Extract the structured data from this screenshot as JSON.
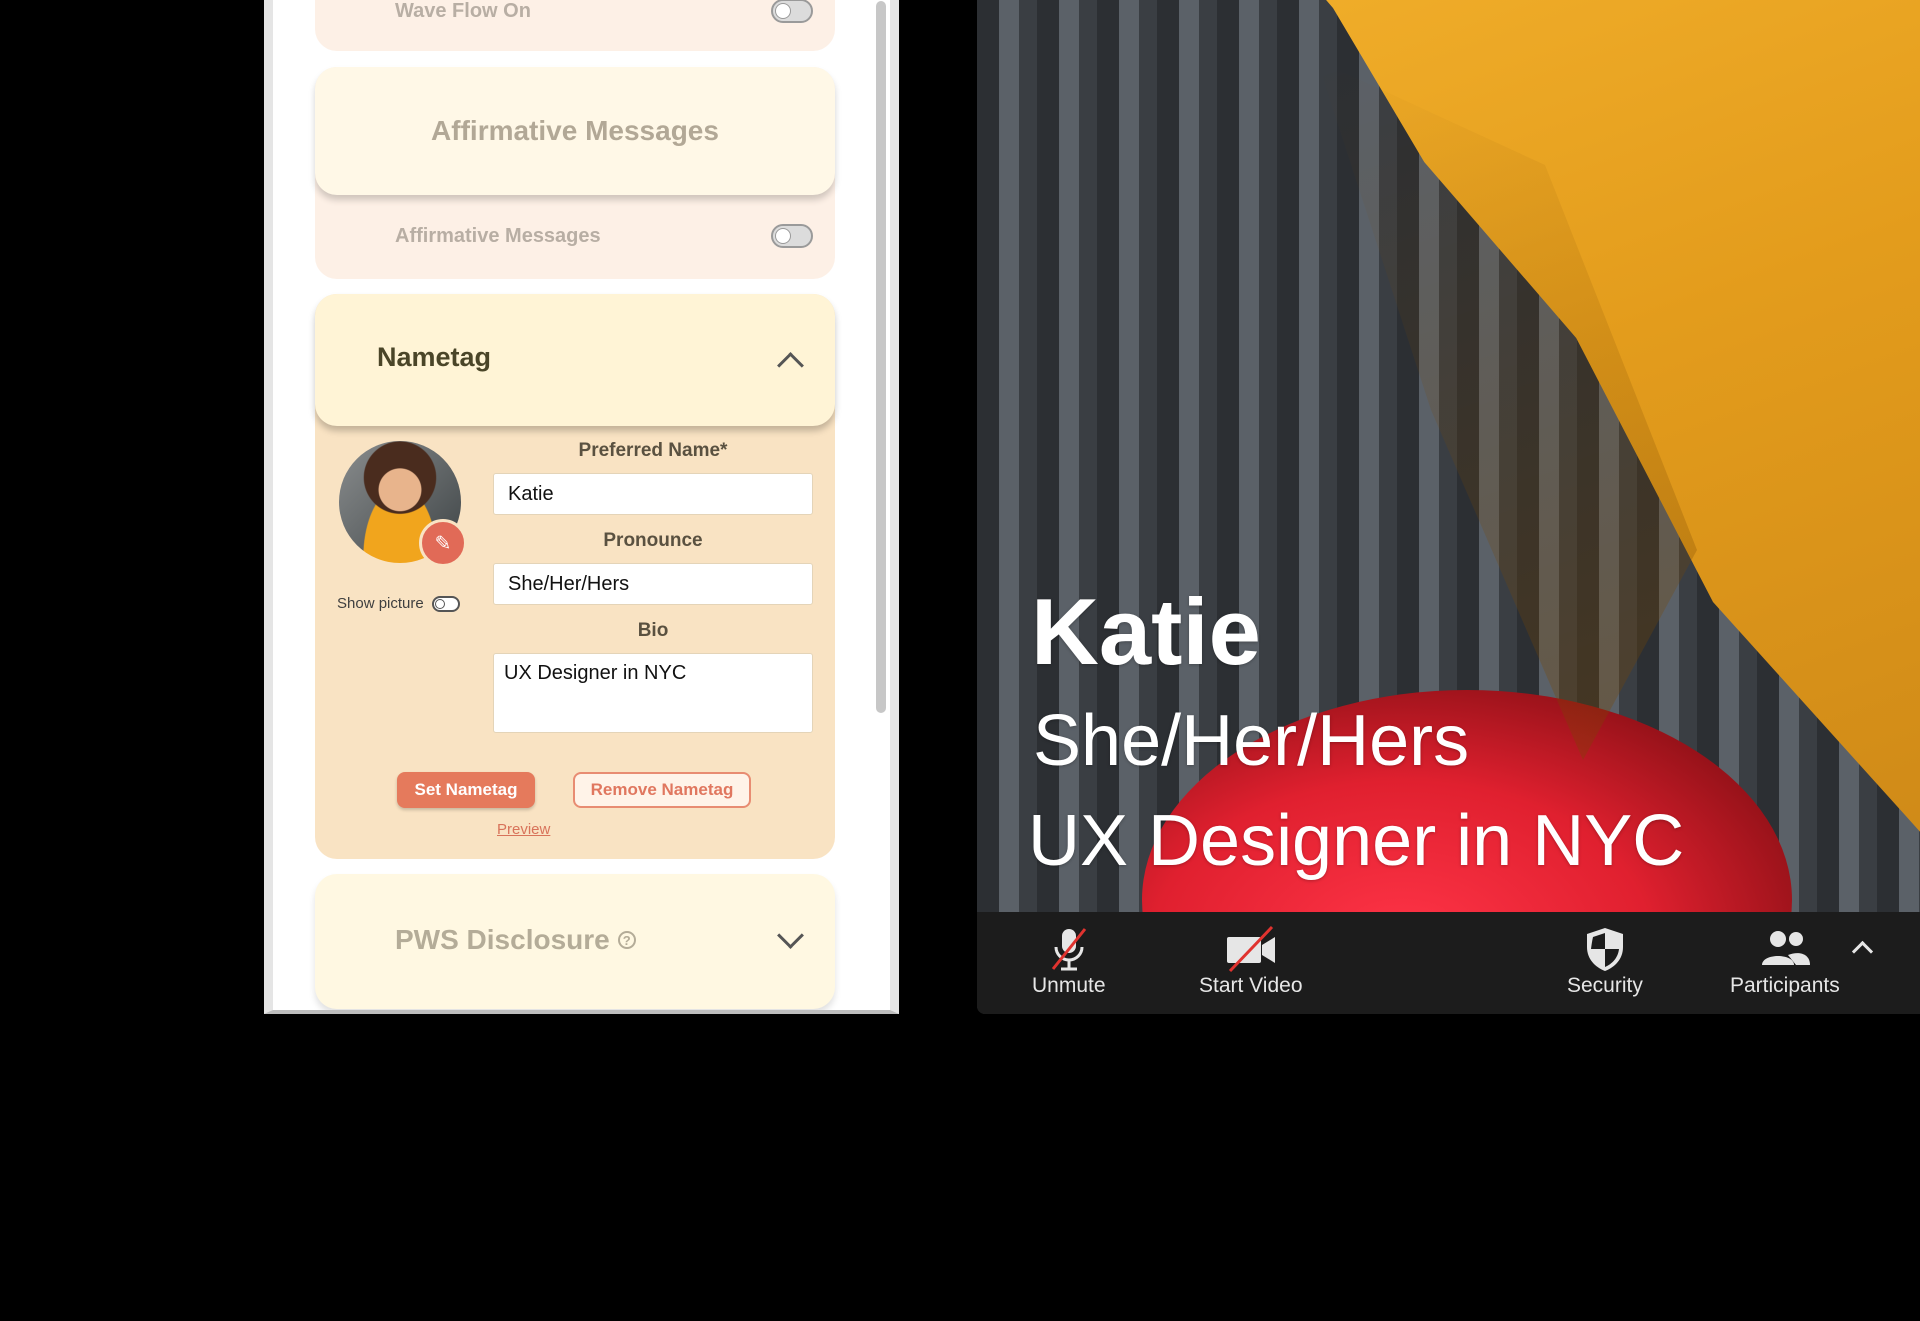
{
  "settings_panel": {
    "wave_flow": {
      "label": "Wave Flow On",
      "enabled": false
    },
    "affirmative": {
      "header": "Affirmative Messages",
      "toggle_label": "Affirmative Messages",
      "enabled": false
    },
    "nametag": {
      "header": "Nametag",
      "preferred_name_label": "Preferred Name*",
      "preferred_name_value": "Katie",
      "pronoun_label": "Pronounce",
      "pronoun_value": "She/Her/Hers",
      "bio_label": "Bio",
      "bio_value": "UX Designer in NYC",
      "show_picture_label": "Show picture",
      "show_picture_enabled": false,
      "set_button": "Set Nametag",
      "remove_button": "Remove Nametag",
      "preview_link": "Preview"
    },
    "pws": {
      "header": "PWS Disclosure",
      "help_glyph": "?"
    }
  },
  "video": {
    "caption_name": "Katie",
    "caption_pronouns": "She/Her/Hers",
    "caption_bio": "UX Designer in NYC"
  },
  "toolbar": {
    "unmute": "Unmute",
    "start_video": "Start Video",
    "security": "Security",
    "participants": "Participants"
  },
  "colors": {
    "accent": "#e57a5c",
    "nametag_bg": "#f9e3c3",
    "toolbar_bg": "#1c1c1c"
  }
}
